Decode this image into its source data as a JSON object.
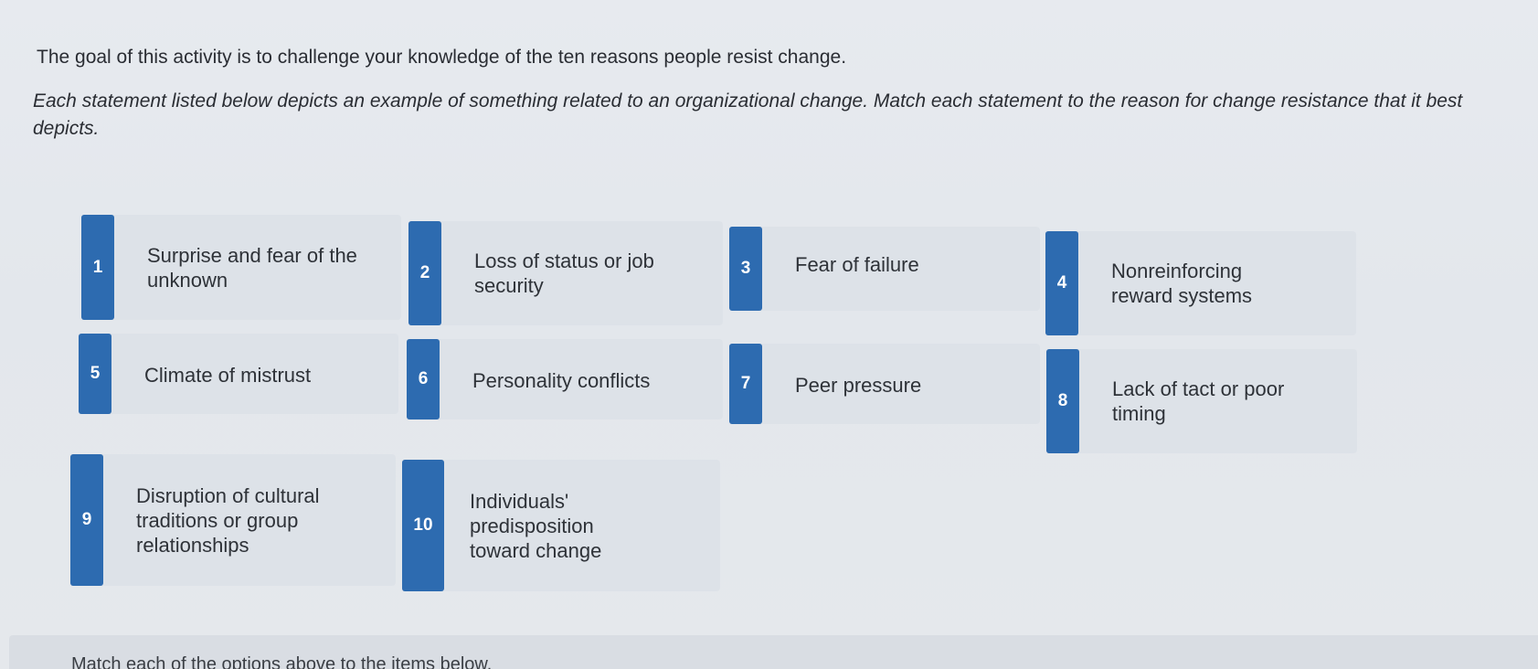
{
  "intro": "The goal of this activity is to challenge your knowledge of the ten reasons people resist change.",
  "instructions": "Each statement listed below depicts an example of something related to an organizational change. Match each statement to the reason for change resistance that it best depicts.",
  "options": [
    {
      "num": "1",
      "label": "Surprise and fear of the unknown"
    },
    {
      "num": "2",
      "label": "Loss of status or job security"
    },
    {
      "num": "3",
      "label": "Fear of failure"
    },
    {
      "num": "4",
      "label": "Nonreinforcing reward systems"
    },
    {
      "num": "5",
      "label": "Climate of mistrust"
    },
    {
      "num": "6",
      "label": "Personality conflicts"
    },
    {
      "num": "7",
      "label": "Peer pressure"
    },
    {
      "num": "8",
      "label": "Lack of tact or poor timing"
    },
    {
      "num": "9",
      "label": "Disruption of cultural traditions or group relationships"
    },
    {
      "num": "10",
      "label": "Individuals' predisposition toward change"
    }
  ],
  "footer_prompt": "Match each of the options above to the items below."
}
